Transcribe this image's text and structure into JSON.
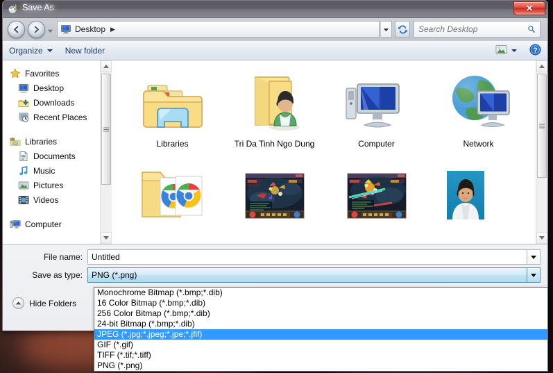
{
  "window": {
    "title": "Save As",
    "title_icon": "paint-icon",
    "close_label": "✕"
  },
  "nav": {
    "back_icon": "back-arrow-icon",
    "forward_icon": "forward-arrow-icon",
    "history_icon": "chevron-down-icon",
    "breadcrumb_icon": "desktop-icon",
    "breadcrumb": "Desktop",
    "breadcrumb_sep": "▶",
    "address_dropdown_icon": "chevron-down-icon",
    "refresh_icon": "refresh-icon",
    "search_placeholder": "Search Desktop",
    "search_value": "",
    "search_icon": "magnifier-icon"
  },
  "toolbar": {
    "organize_label": "Organize",
    "new_folder_label": "New folder",
    "views_icon": "views-icon",
    "views_caret_icon": "chevron-down-icon",
    "help_icon": "help-icon",
    "help_label": "?"
  },
  "navpane": {
    "groups": [
      {
        "root": "Favorites",
        "root_icon": "star-icon",
        "items": [
          {
            "label": "Desktop",
            "icon": "desktop-icon"
          },
          {
            "label": "Downloads",
            "icon": "downloads-icon"
          },
          {
            "label": "Recent Places",
            "icon": "recent-places-icon"
          }
        ]
      },
      {
        "root": "Libraries",
        "root_icon": "libraries-icon",
        "items": [
          {
            "label": "Documents",
            "icon": "documents-icon"
          },
          {
            "label": "Music",
            "icon": "music-icon"
          },
          {
            "label": "Pictures",
            "icon": "pictures-icon"
          },
          {
            "label": "Videos",
            "icon": "videos-icon"
          }
        ]
      },
      {
        "root": "Computer",
        "root_icon": "computer-icon",
        "items": []
      }
    ]
  },
  "filelist": {
    "row1": [
      {
        "label": "Libraries",
        "icon": "libraries-folder-icon"
      },
      {
        "label": "Tri Da Tinh Ngo Dung",
        "icon": "user-folder-icon"
      },
      {
        "label": "Computer",
        "icon": "computer-icon"
      },
      {
        "label": "Network",
        "icon": "network-icon"
      }
    ],
    "row2": [
      {
        "label": "",
        "icon": "chrome-folder-icon"
      },
      {
        "label": "",
        "icon": "game-screenshot-1"
      },
      {
        "label": "",
        "icon": "game-screenshot-2"
      },
      {
        "label": "",
        "icon": "portrait-photo"
      }
    ]
  },
  "form": {
    "filename_label": "File name:",
    "filename_value": "Untitled",
    "filename_dropdown_icon": "chevron-down-icon",
    "savetype_label": "Save as type:",
    "savetype_value": "PNG (*.png)",
    "savetype_dropdown_icon": "chevron-down-icon",
    "hide_folders_label": "Hide Folders",
    "hide_folders_icon": "chevron-up-circle-icon"
  },
  "dropdown": {
    "selected_index": 4,
    "options": [
      "Monochrome Bitmap (*.bmp;*.dib)",
      "16 Color Bitmap (*.bmp;*.dib)",
      "256 Color Bitmap (*.bmp;*.dib)",
      "24-bit Bitmap (*.bmp;*.dib)",
      "JPEG (*.jpg;*.jpeg;*.jpe;*.jfif)",
      "GIF (*.gif)",
      "TIFF (*.tif;*.tiff)",
      "PNG (*.png)"
    ]
  },
  "colors": {
    "selection_blue": "#3399ff",
    "close_red": "#c9261d",
    "toolbar_text": "#1b3a6b"
  }
}
